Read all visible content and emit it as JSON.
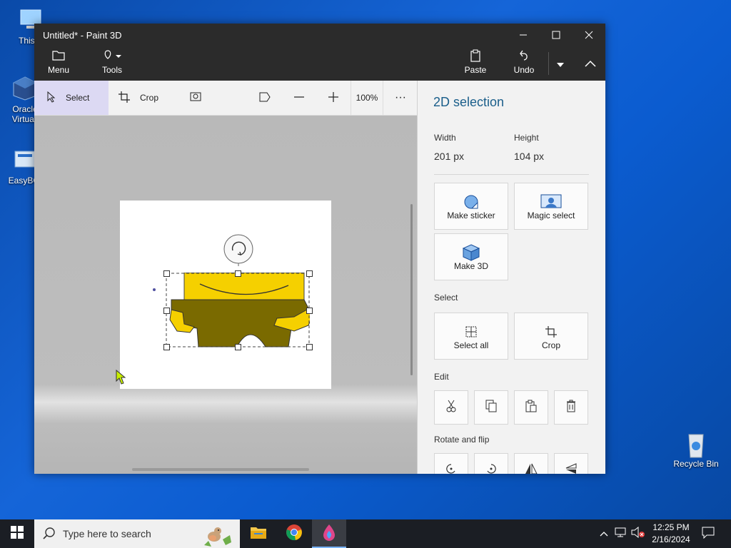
{
  "desktop": {
    "icons": [
      {
        "label": "This P"
      },
      {
        "label": "Oracle\nVirtuall"
      },
      {
        "label": "EasyBCI"
      },
      {
        "label": "Recycle Bin"
      }
    ]
  },
  "window": {
    "title": "Untitled* - Paint 3D",
    "ribbon": {
      "menu": "Menu",
      "tools": "Tools",
      "paste": "Paste",
      "undo": "Undo"
    }
  },
  "toolbar": {
    "select": "Select",
    "crop": "Crop",
    "zoom": "100%",
    "more": "···"
  },
  "panel": {
    "title": "2D selection",
    "width_label": "Width",
    "width_value": "201 px",
    "height_label": "Height",
    "height_value": "104 px",
    "make_sticker": "Make sticker",
    "magic_select": "Magic select",
    "make_3d": "Make 3D",
    "select_section": "Select",
    "select_all": "Select all",
    "crop": "Crop",
    "edit_section": "Edit",
    "rotate_section": "Rotate and flip"
  },
  "taskbar": {
    "search_placeholder": "Type here to search",
    "time": "12:25 PM",
    "date": "2/16/2024"
  },
  "colors": {
    "accent": "#1a5e8a",
    "selected_tool": "#dcd9f3",
    "figure_yellow": "#f5d000",
    "figure_olive": "#7a6a00"
  }
}
